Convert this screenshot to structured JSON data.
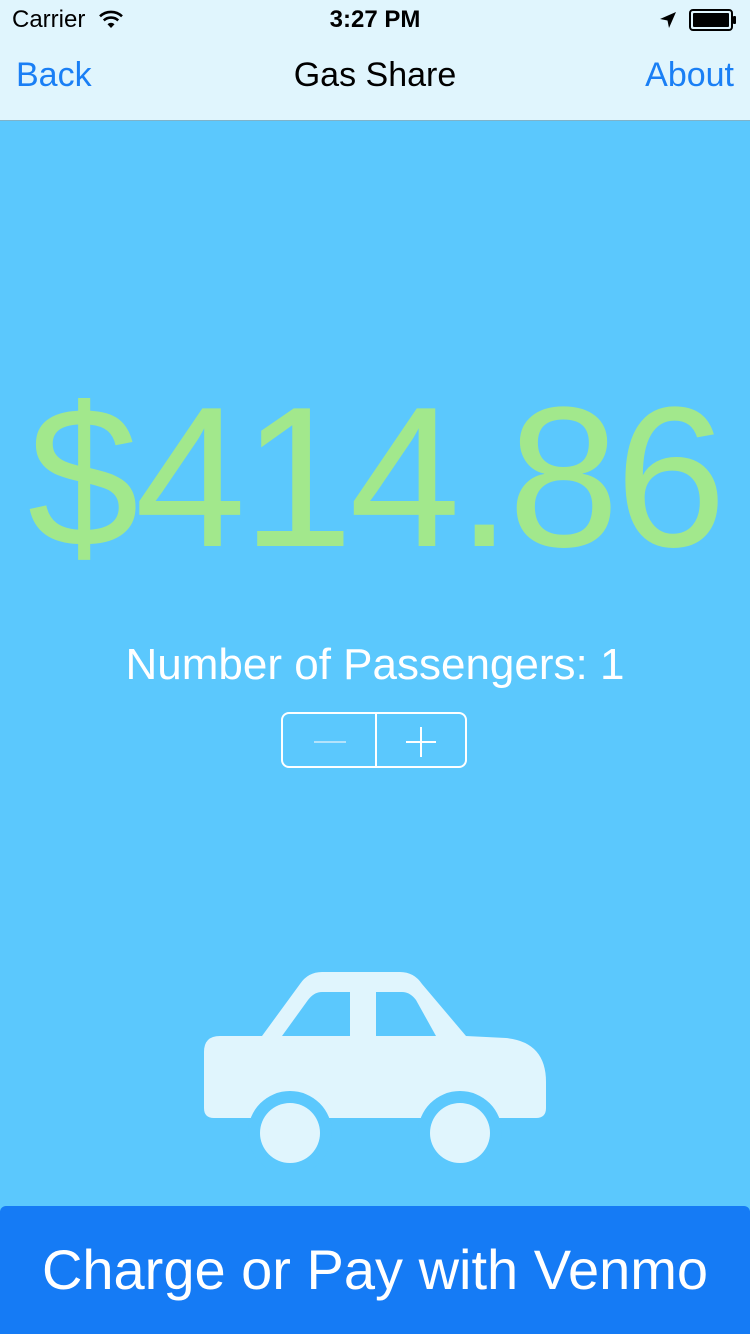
{
  "status_bar": {
    "carrier": "Carrier",
    "time": "3:27 PM"
  },
  "nav": {
    "back_label": "Back",
    "title": "Gas Share",
    "about_label": "About"
  },
  "main": {
    "amount": "$414.86",
    "passengers_label": "Number of Passengers: 1",
    "passenger_count": 1
  },
  "stepper": {
    "minus_enabled": false,
    "plus_enabled": true
  },
  "footer": {
    "venmo_label": "Charge or Pay with Venmo"
  },
  "colors": {
    "background": "#5bc8fd",
    "bar_background": "#e0f5fd",
    "link": "#1a7ff5",
    "amount": "#a2e88c",
    "button": "#157bf5",
    "car": "#e0f5fd"
  },
  "icons": {
    "wifi": "wifi-icon",
    "location": "location-arrow-icon",
    "battery": "battery-icon",
    "car": "car-icon",
    "minus": "minus-icon",
    "plus": "plus-icon"
  }
}
